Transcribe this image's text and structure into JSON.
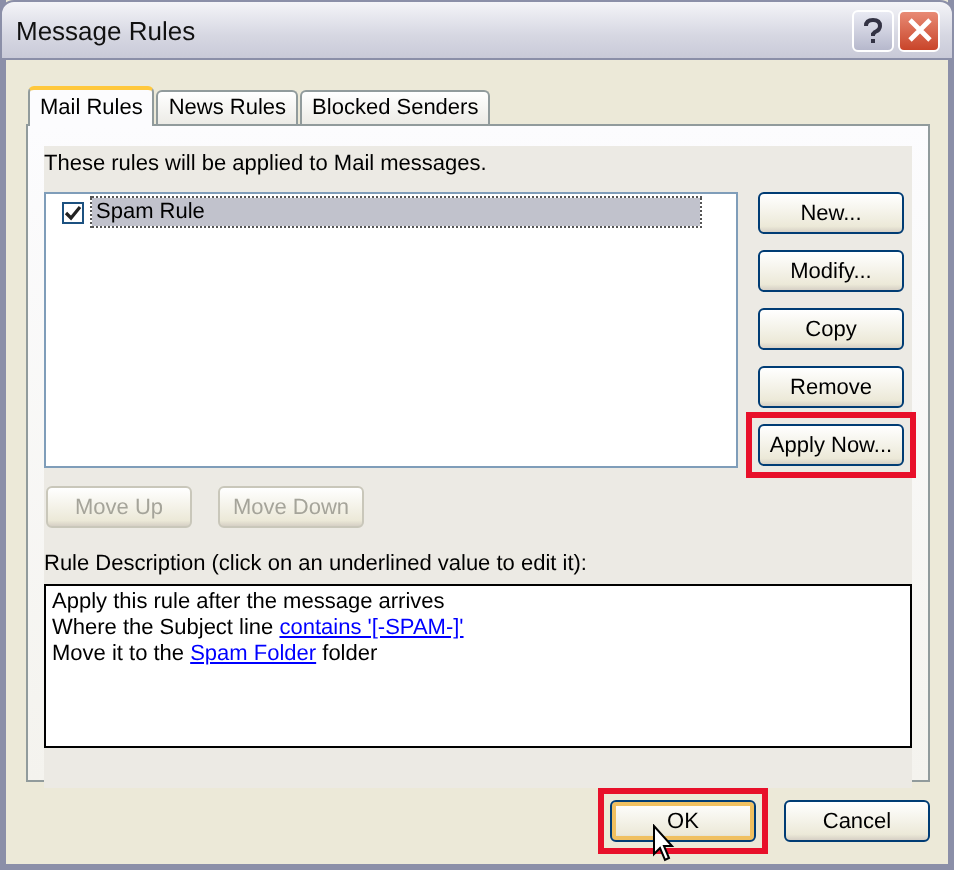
{
  "window": {
    "title": "Message Rules"
  },
  "tabs": [
    {
      "label": "Mail Rules",
      "selected": true
    },
    {
      "label": "News Rules",
      "selected": false
    },
    {
      "label": "Blocked Senders",
      "selected": false
    }
  ],
  "intro": "These rules will be applied to Mail messages.",
  "rules": [
    {
      "name": "Spam Rule",
      "checked": true,
      "selected": true
    }
  ],
  "side_buttons": [
    {
      "label": "New...",
      "highlighted": false
    },
    {
      "label": "Modify...",
      "highlighted": false
    },
    {
      "label": "Copy",
      "highlighted": false
    },
    {
      "label": "Remove",
      "highlighted": false
    },
    {
      "label": "Apply Now...",
      "highlighted": true
    }
  ],
  "move_buttons": [
    {
      "label": "Move Up",
      "disabled": true
    },
    {
      "label": "Move Down",
      "disabled": true
    }
  ],
  "description_label": "Rule Description (click on an underlined value to edit it):",
  "description_lines": [
    {
      "parts": [
        {
          "text": "Apply this rule after the message arrives",
          "link": false
        }
      ]
    },
    {
      "parts": [
        {
          "text": "Where the Subject line ",
          "link": false
        },
        {
          "text": "contains '[-SPAM-]'",
          "link": true
        }
      ]
    },
    {
      "parts": [
        {
          "text": "Move it to the ",
          "link": false
        },
        {
          "text": "Spam Folder",
          "link": true
        },
        {
          "text": " folder",
          "link": false
        }
      ]
    }
  ],
  "footer_buttons": [
    {
      "label": "OK",
      "highlighted": true,
      "default": true
    },
    {
      "label": "Cancel",
      "highlighted": false,
      "default": false
    }
  ]
}
